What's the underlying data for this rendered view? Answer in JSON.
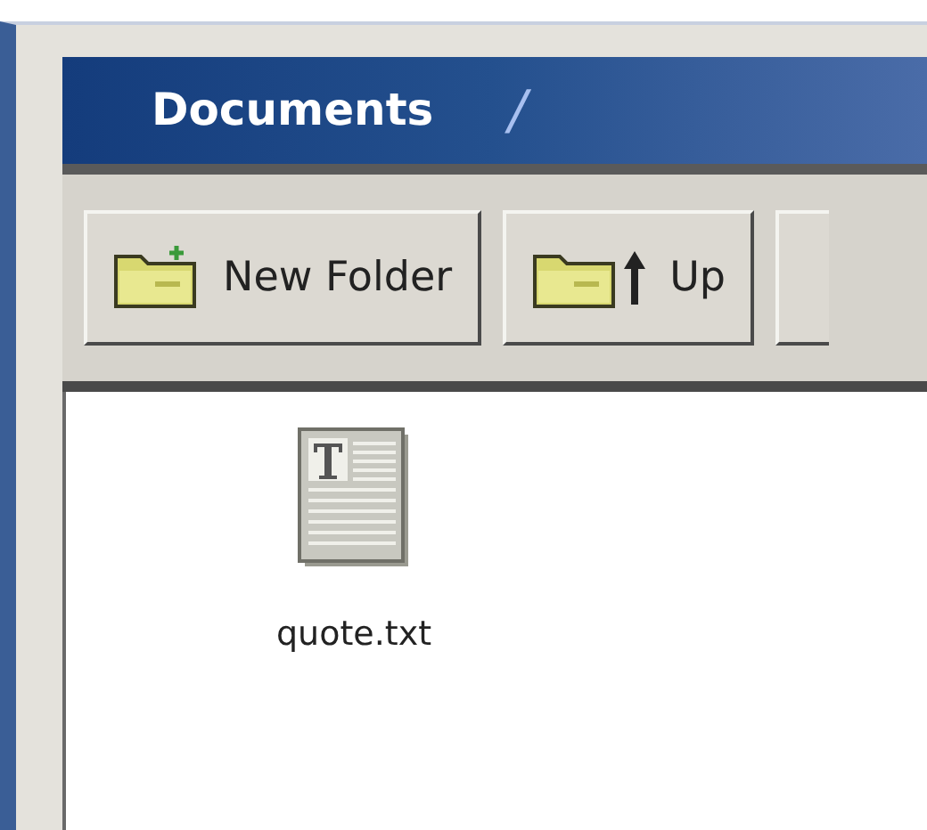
{
  "path_bar": {
    "folder": "Documents",
    "separator": "/"
  },
  "toolbar": {
    "buttons": [
      {
        "label": "New Folder",
        "kind": "new-folder"
      },
      {
        "label": "Up",
        "kind": "up"
      }
    ]
  },
  "files": [
    {
      "name": "quote.txt",
      "kind": "text"
    }
  ]
}
